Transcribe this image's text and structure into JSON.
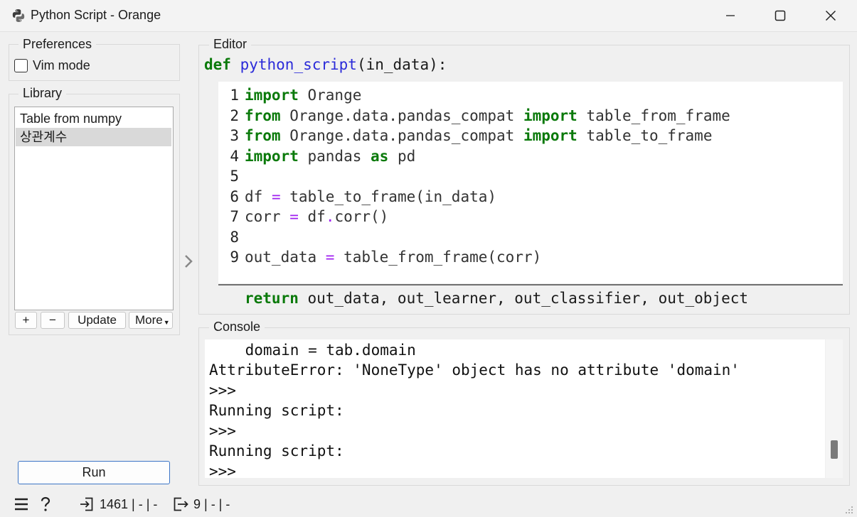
{
  "window": {
    "title": "Python Script - Orange",
    "icon": "python-icon",
    "controls": [
      "minimize-icon",
      "maximize-icon",
      "close-icon"
    ]
  },
  "preferences": {
    "title": "Preferences",
    "vim_mode_label": "Vim mode",
    "vim_mode_checked": false
  },
  "library": {
    "title": "Library",
    "items": [
      {
        "label": "Table from numpy",
        "selected": false
      },
      {
        "label": "상관계수",
        "selected": true
      }
    ],
    "buttons": {
      "add": "+",
      "remove": "−",
      "update": "Update",
      "more": "More"
    }
  },
  "run_label": "Run",
  "editor": {
    "title": "Editor",
    "header": {
      "def": "def",
      "name": "python_script",
      "args": "(in_data):"
    },
    "lines": [
      {
        "num": "1"
      },
      {
        "num": "2"
      },
      {
        "num": "3"
      },
      {
        "num": "4"
      },
      {
        "num": "5"
      },
      {
        "num": "6"
      },
      {
        "num": "7"
      },
      {
        "num": "8"
      },
      {
        "num": "9"
      }
    ],
    "code": {
      "l1": {
        "kw": "import",
        "rest": " Orange"
      },
      "l2": {
        "kw": "from",
        "mod": " Orange.data.pandas_compat ",
        "kw2": "import",
        "rest": " table_from_frame"
      },
      "l3": {
        "kw": "from",
        "mod": " Orange.data.pandas_compat ",
        "kw2": "import",
        "rest": " table_to_frame"
      },
      "l4": {
        "kw": "import",
        "mod": " pandas ",
        "kw2": "as",
        "rest": " pd"
      },
      "l6": {
        "a": "df ",
        "op": "=",
        "b": " table_to_frame(in_data)"
      },
      "l7": {
        "a": "corr ",
        "op": "=",
        "b": " df",
        "op2": ".",
        "c": "corr()"
      },
      "l9": {
        "a": "out_data ",
        "op": "=",
        "b": " table_from_frame(corr)"
      }
    },
    "footer": {
      "kw": "return",
      "rest": " out_data, out_learner, out_classifier, out_object"
    }
  },
  "console": {
    "title": "Console",
    "lines": [
      "    domain = tab.domain",
      "AttributeError: 'NoneType' object has no attribute 'domain'",
      ">>>",
      "Running script:",
      ">>>",
      "Running script:",
      ">>>"
    ]
  },
  "status": {
    "menu_icon": "hamburger-icon",
    "help_icon": "question-icon",
    "input_summary": "1461 | - | -",
    "output_summary": "9 | - | -"
  }
}
